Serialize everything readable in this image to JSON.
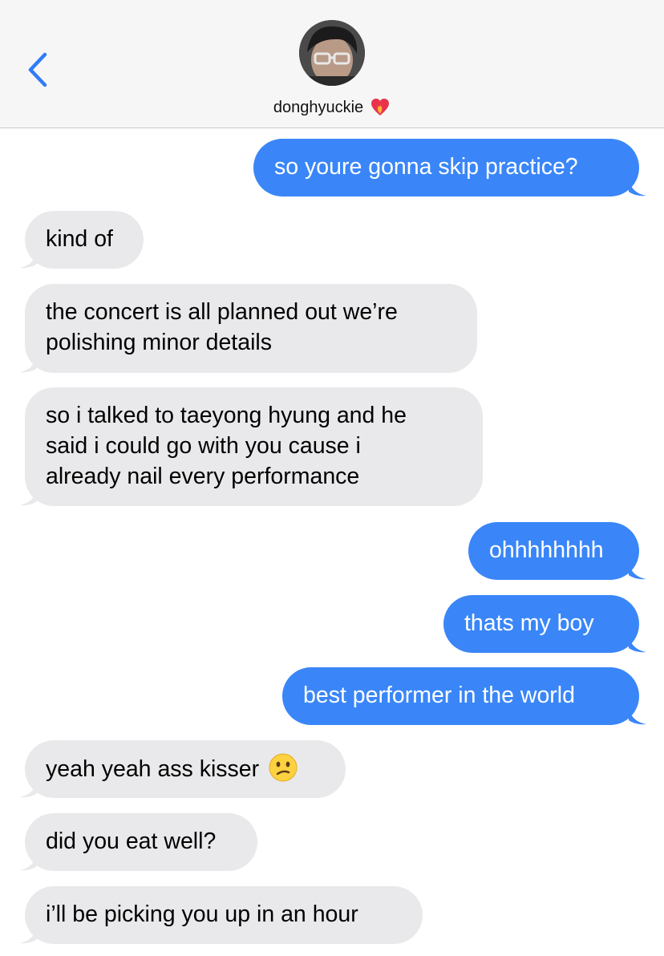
{
  "header": {
    "contact_name": "donghyuckie",
    "back_icon": "chevron-left-icon",
    "heart_icon": "heart-on-fire-icon",
    "avatar": "contact-avatar"
  },
  "colors": {
    "sent": "#3a86f8",
    "received": "#e9e9eb",
    "accent": "#2f7cf6"
  },
  "messages": [
    {
      "from": "me",
      "text": "so youre gonna skip practice?"
    },
    {
      "from": "them",
      "text": "kind of"
    },
    {
      "from": "them",
      "lines": [
        "the concert is all planned out we’re",
        "polishing minor details"
      ]
    },
    {
      "from": "them",
      "lines": [
        "so i talked to taeyong hyung and he",
        "said i could go with you cause i",
        "already nail every performance"
      ]
    },
    {
      "from": "me",
      "text": "ohhhhhhhh"
    },
    {
      "from": "me",
      "text": "thats my boy"
    },
    {
      "from": "me",
      "text": "best performer in the world"
    },
    {
      "from": "them",
      "text": "yeah yeah ass kisser",
      "emoji": "confused-face-emoji"
    },
    {
      "from": "them",
      "text": "did you eat well?"
    },
    {
      "from": "them",
      "text": "i’ll be picking you up in an hour"
    }
  ]
}
